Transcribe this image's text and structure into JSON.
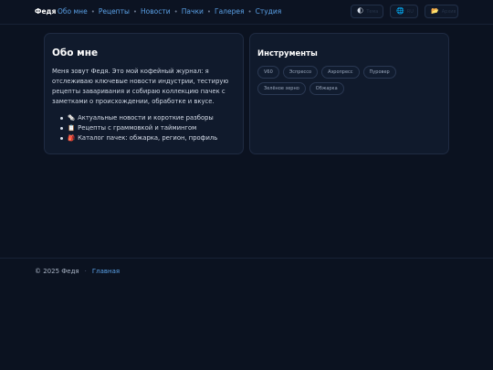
{
  "header": {
    "brand": "Федя",
    "nav": [
      "Обо мне",
      "Рецепты",
      "Новости",
      "Пачки",
      "Галерея",
      "Студия"
    ],
    "buttons": [
      {
        "icon": "moon-icon",
        "glyph": "🌓",
        "label": "Тема"
      },
      {
        "icon": "globe-icon",
        "glyph": "🌐",
        "label": "RU"
      },
      {
        "icon": "folder-icon",
        "glyph": "📂",
        "label": "Архив"
      }
    ]
  },
  "about": {
    "title": "Обо мне",
    "text": "Меня зовут Федя. Это мой кофейный журнал: я отслеживаю ключевые новости индустрии, тестирую рецепты заваривания и собираю коллекцию пачек с заметками о происхождении, обработке и вкусе.",
    "items": [
      {
        "emoji": "🗞️",
        "text": "Актуальные новости и короткие разборы"
      },
      {
        "emoji": "📋",
        "text": "Рецепты с граммовкой и таймингом"
      },
      {
        "emoji": "🎒",
        "text": "Каталог пачек: обжарка, регион, профиль"
      }
    ]
  },
  "tools": {
    "title": "Инструменты",
    "chips": [
      "V60",
      "Эспрессо",
      "Аэропресс",
      "Пуровер",
      "Зелёное зерно",
      "Обжарка"
    ]
  },
  "footer": {
    "copyright": "© 2025 Федя",
    "separator": "·",
    "link": "Главная"
  }
}
